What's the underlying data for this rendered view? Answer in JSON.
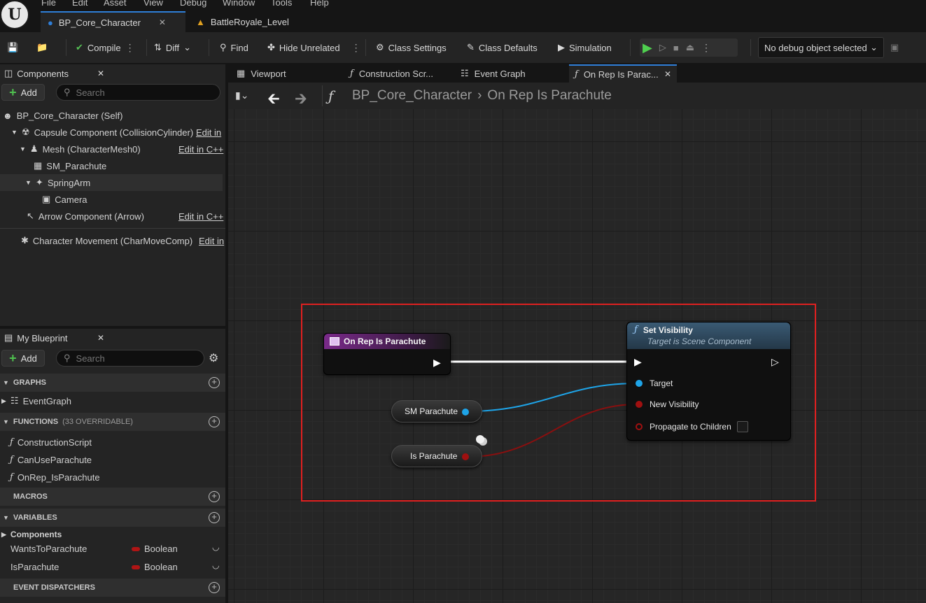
{
  "menu": [
    "File",
    "Edit",
    "Asset",
    "View",
    "Debug",
    "Window",
    "Tools",
    "Help"
  ],
  "tabs": [
    {
      "label": "BP_Core_Character",
      "icon": "person-icon"
    },
    {
      "label": "BattleRoyale_Level",
      "icon": "level-icon"
    }
  ],
  "toolbar": {
    "compile": "Compile",
    "diff": "Diff",
    "find": "Find",
    "hide_unrelated": "Hide Unrelated",
    "class_settings": "Class Settings",
    "class_defaults": "Class Defaults",
    "simulation": "Simulation",
    "debug_object": "No debug object selected"
  },
  "components": {
    "title": "Components",
    "add": "Add",
    "search_placeholder": "Search",
    "edit_in": "Edit in",
    "edit_in_cpp": "Edit in C++",
    "items": [
      "BP_Core_Character (Self)",
      "Capsule Component (CollisionCylinder)",
      "Mesh (CharacterMesh0)",
      "SM_Parachute",
      "SpringArm",
      "Camera",
      "Arrow Component (Arrow)",
      "Character Movement (CharMoveComp)"
    ]
  },
  "my_blueprint": {
    "title": "My Blueprint",
    "add": "Add",
    "search_placeholder": "Search",
    "graphs_header": "GRAPHS",
    "graphs": [
      "EventGraph"
    ],
    "functions_header": "FUNCTIONS",
    "functions_count": "(33 OVERRIDABLE)",
    "functions": [
      "ConstructionScript",
      "CanUseParachute",
      "OnRep_IsParachute"
    ],
    "macros_header": "MACROS",
    "variables_header": "VARIABLES",
    "variables_category": "Components",
    "variables": [
      {
        "name": "WantsToParachute",
        "type": "Boolean"
      },
      {
        "name": "IsParachute",
        "type": "Boolean"
      }
    ],
    "dispatchers_header": "EVENT DISPATCHERS"
  },
  "graph_tabs": [
    "Viewport",
    "Construction Scr...",
    "Event Graph",
    "On Rep Is Parac..."
  ],
  "breadcrumb": {
    "root": "BP_Core_Character",
    "current": "On Rep Is Parachute"
  },
  "nodes": {
    "entry_title": "On Rep Is Parachute",
    "set_visibility_title": "Set Visibility",
    "set_visibility_subtitle": "Target is Scene Component",
    "pin_target": "Target",
    "pin_new_visibility": "New Visibility",
    "pin_propagate": "Propagate to Children",
    "get_sm_parachute": "SM Parachute",
    "get_is_parachute": "Is Parachute"
  },
  "colors": {
    "accent": "#2f7fd8",
    "highlight_box": "#e02020",
    "object_pin": "#1ea4e8",
    "bool_pin": "#a01010",
    "function_header": "#7a2a8a"
  }
}
